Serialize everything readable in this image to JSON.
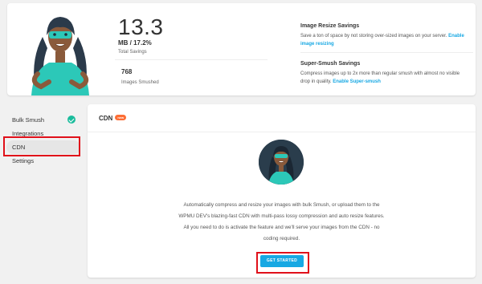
{
  "summary": {
    "total_savings_value": "13.3",
    "size_line": "MB / 17.2%",
    "total_savings_label": "Total Savings",
    "images_smushed_count": "768",
    "images_smushed_label": "Images Smushed",
    "resize": {
      "title": "Image Resize Savings",
      "desc": "Save a ton of space by not storing over-sized images on your server.",
      "link": "Enable image resizing"
    },
    "super": {
      "title": "Super-Smush Savings",
      "desc": "Compress images up to 2x more than regular smush with almost no visible drop in quality.",
      "link": "Enable Super-smush"
    }
  },
  "sidebar": {
    "items": [
      {
        "label": "Bulk Smush",
        "checked": true
      },
      {
        "label": "Integrations"
      },
      {
        "label": "CDN",
        "active": true
      },
      {
        "label": "Settings"
      }
    ]
  },
  "panel": {
    "title": "CDN",
    "badge": "new",
    "text": "Automatically compress and resize your images with bulk Smush, or upload them to the WPMU DEV's blazing-fast CDN with multi-pass lossy compression and auto resize features. All you need to do is activate the feature and we'll serve your images from the CDN - no coding required.",
    "button": "GET STARTED"
  },
  "colors": {
    "accent": "#17a8e3",
    "success": "#1abc9c",
    "badge": "#fd6e35",
    "highlight": "#e0101a"
  },
  "icons": {
    "check": "check-circle-icon",
    "mascot": "mascot-illustration"
  }
}
